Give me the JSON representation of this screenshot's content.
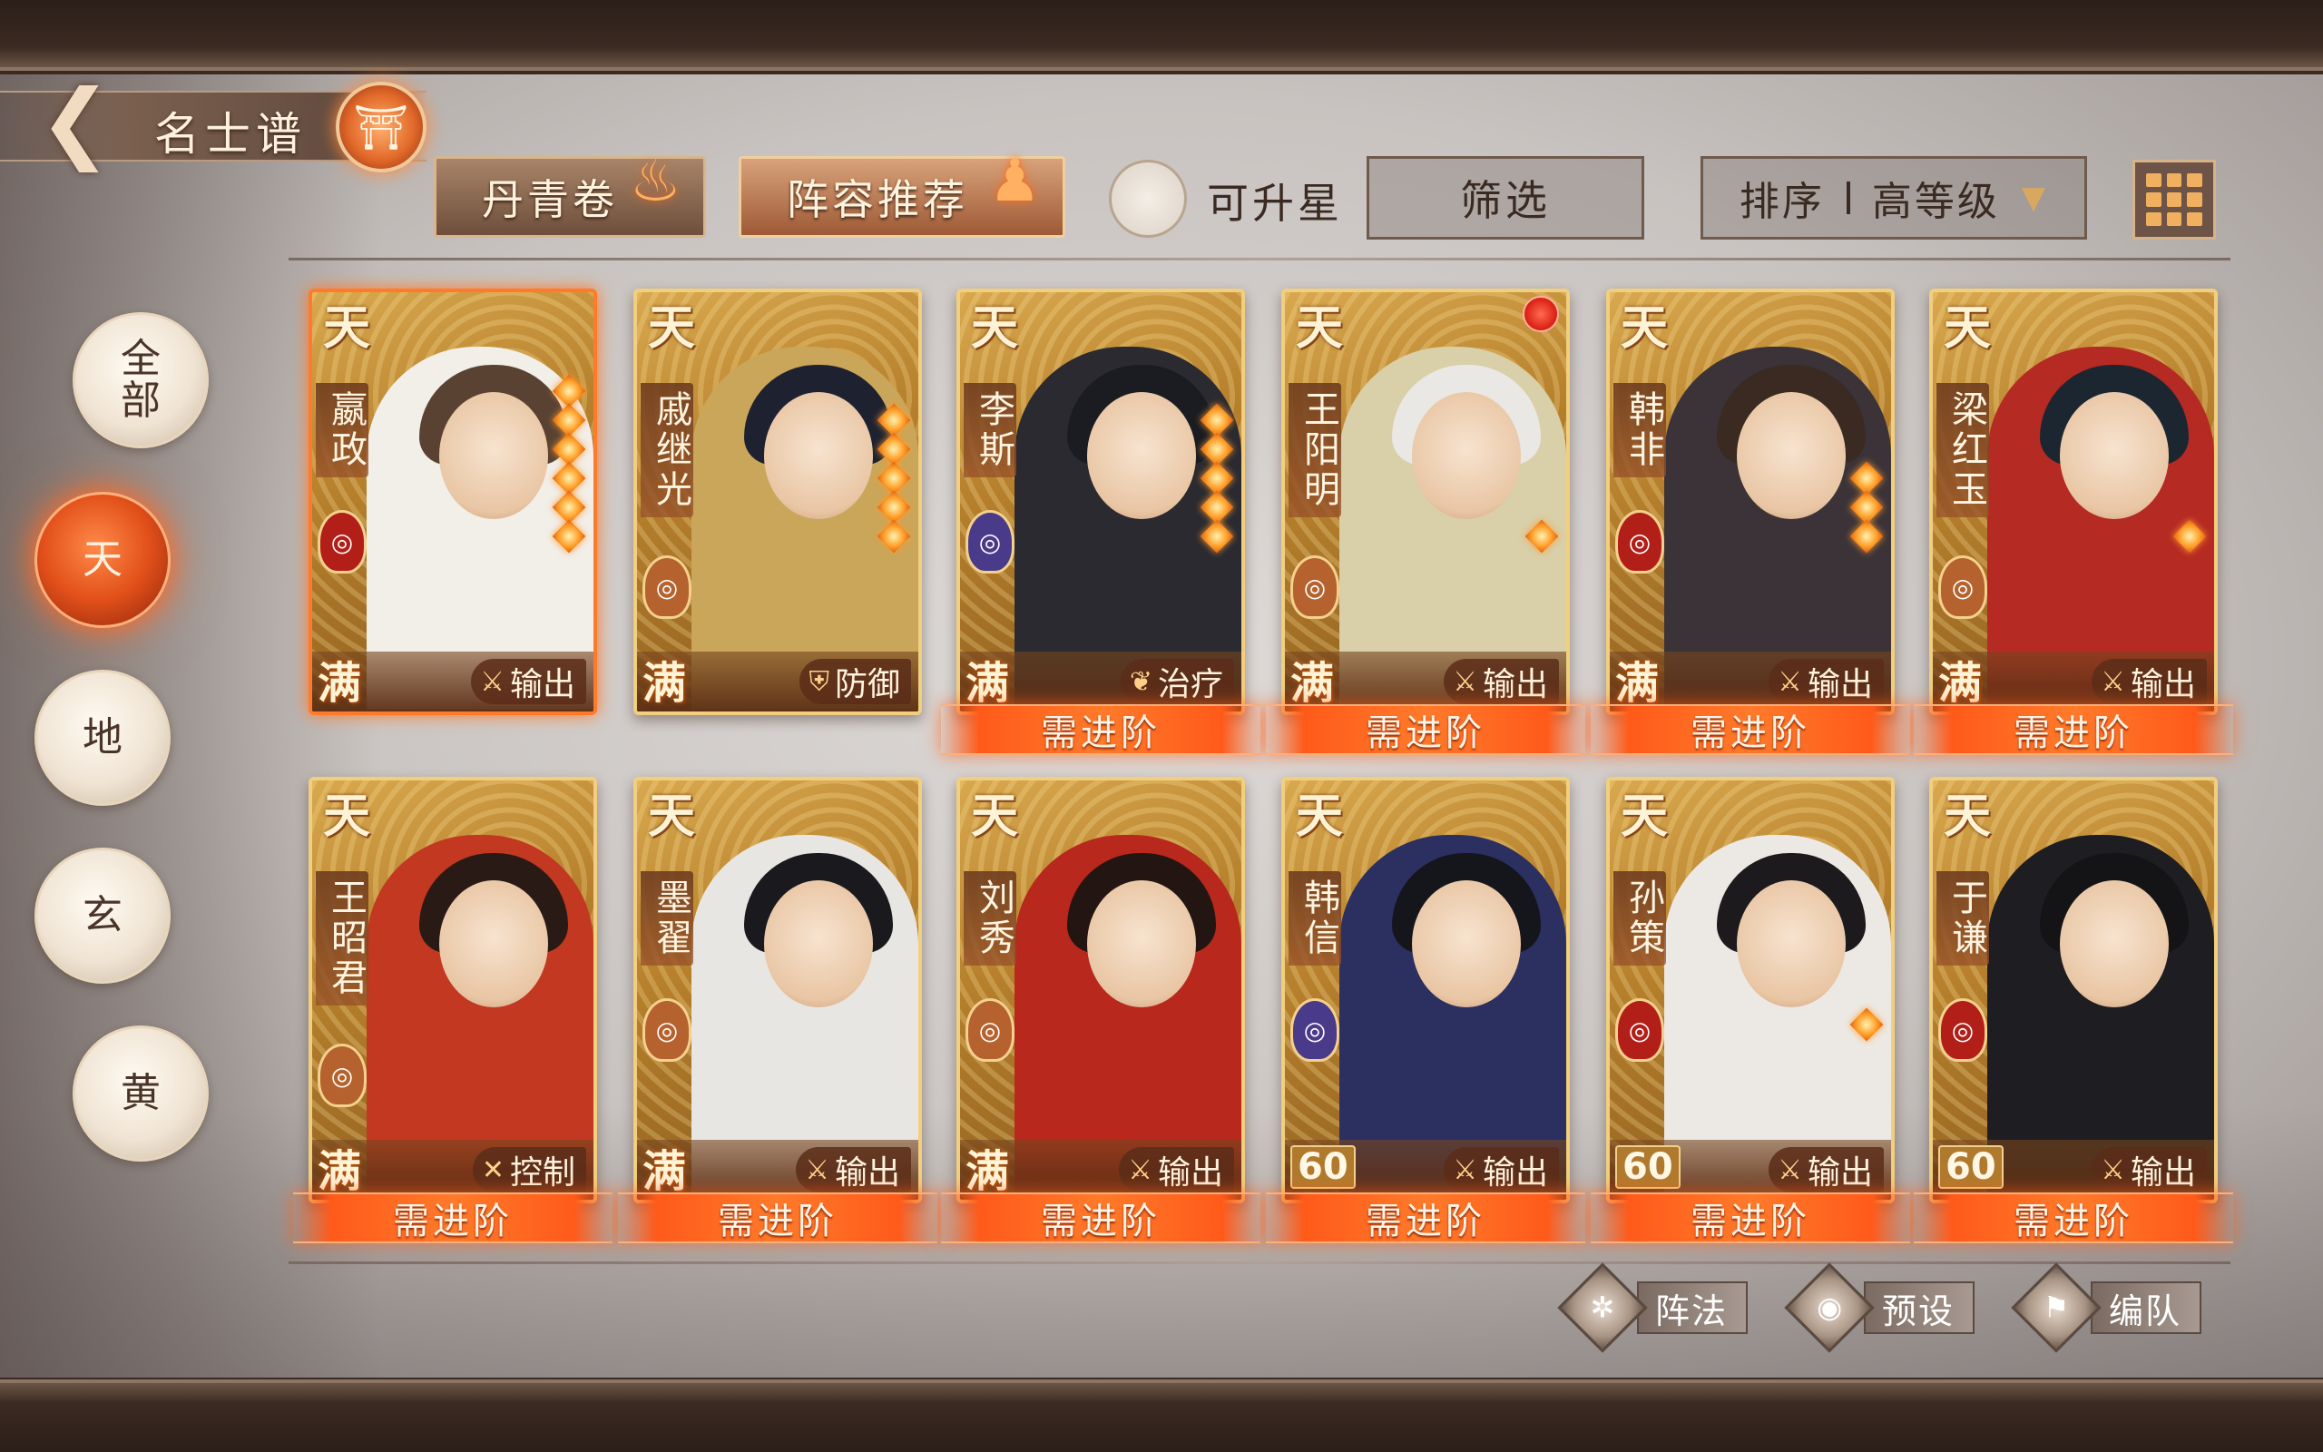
{
  "header": {
    "back_icon": "arrow-left-icon",
    "title": "名士谱",
    "tabs": [
      {
        "label": "丹青卷",
        "icon": "flame-icon"
      },
      {
        "label": "阵容推荐",
        "icon": "dancer-icon"
      }
    ],
    "upgrade_label": "可升星",
    "filter_label": "筛选",
    "sort_label": "排序",
    "sort_value": "高等级",
    "view_icon": "grid-icon"
  },
  "categories": [
    {
      "label_1": "全",
      "label_2": "部",
      "active": false
    },
    {
      "label_1": "天",
      "label_2": "",
      "active": true
    },
    {
      "label_1": "地",
      "label_2": "",
      "active": false
    },
    {
      "label_1": "玄",
      "label_2": "",
      "active": false
    },
    {
      "label_1": "黄",
      "label_2": "",
      "active": false
    }
  ],
  "advance_label": "需进阶",
  "cards": [
    {
      "tier": "天",
      "name": "嬴政",
      "level": "满",
      "role": "输出",
      "role_icon": "sword-icon",
      "faction_color": "#b21e18",
      "hair": "#5a4232",
      "robe": "#f2eee8",
      "stars": 6,
      "needs_advance": false,
      "selected": true
    },
    {
      "tier": "天",
      "name": "戚继光",
      "level": "满",
      "role": "防御",
      "role_icon": "shield-icon",
      "faction_color": "#b5622e",
      "hair": "#1e2230",
      "robe": "#c9a65a",
      "stars": 5,
      "needs_advance": false,
      "selected": false
    },
    {
      "tier": "天",
      "name": "李斯",
      "level": "满",
      "role": "治疗",
      "role_icon": "leaf-icon",
      "faction_color": "#4a3a8a",
      "hair": "#1a1c22",
      "robe": "#2a2a30",
      "stars": 5,
      "needs_advance": true,
      "selected": false
    },
    {
      "tier": "天",
      "name": "王阳明",
      "level": "满",
      "role": "输出",
      "role_icon": "sword-icon",
      "faction_color": "#b5622e",
      "hair": "#eae8e4",
      "robe": "#d9cfa8",
      "stars": 1,
      "needs_advance": true,
      "selected": false,
      "badge": true
    },
    {
      "tier": "天",
      "name": "韩非",
      "level": "满",
      "role": "输出",
      "role_icon": "sword-icon",
      "faction_color": "#b21e18",
      "hair": "#3a2a22",
      "robe": "#3b3338",
      "stars": 3,
      "needs_advance": true,
      "selected": false
    },
    {
      "tier": "天",
      "name": "梁红玉",
      "level": "满",
      "role": "输出",
      "role_icon": "sword-icon",
      "faction_color": "#b5622e",
      "hair": "#1c2630",
      "robe": "#b52a22",
      "stars": 1,
      "needs_advance": true,
      "selected": false
    },
    {
      "tier": "天",
      "name": "王昭君",
      "level": "满",
      "role": "控制",
      "role_icon": "cross-icon",
      "faction_color": "#b5622e",
      "hair": "#2a1a16",
      "robe": "#c23820",
      "stars": 0,
      "needs_advance": true,
      "selected": false
    },
    {
      "tier": "天",
      "name": "墨翟",
      "level": "满",
      "role": "输出",
      "role_icon": "sword-icon",
      "faction_color": "#b5622e",
      "hair": "#1a1a1e",
      "robe": "#e8e6e2",
      "stars": 0,
      "needs_advance": true,
      "selected": false
    },
    {
      "tier": "天",
      "name": "刘秀",
      "level": "满",
      "role": "输出",
      "role_icon": "sword-icon",
      "faction_color": "#b5622e",
      "hair": "#231612",
      "robe": "#b8281c",
      "stars": 0,
      "needs_advance": true,
      "selected": false
    },
    {
      "tier": "天",
      "name": "韩信",
      "level": "60",
      "role": "输出",
      "role_icon": "sword-icon",
      "faction_color": "#4a3a8a",
      "hair": "#15161c",
      "robe": "#2c3060",
      "stars": 0,
      "needs_advance": true,
      "selected": false
    },
    {
      "tier": "天",
      "name": "孙策",
      "level": "60",
      "role": "输出",
      "role_icon": "sword-icon",
      "faction_color": "#b21e18",
      "hair": "#1c1a1c",
      "robe": "#ece9e4",
      "stars": 1,
      "needs_advance": true,
      "selected": false
    },
    {
      "tier": "天",
      "name": "于谦",
      "level": "60",
      "role": "输出",
      "role_icon": "sword-icon",
      "faction_color": "#b21e18",
      "hair": "#141416",
      "robe": "#1e1e22",
      "stars": 0,
      "needs_advance": true,
      "selected": false
    }
  ],
  "actions": [
    {
      "label": "阵法",
      "icon": "formation-icon"
    },
    {
      "label": "预设",
      "icon": "preset-icon"
    },
    {
      "label": "编队",
      "icon": "banner-icon"
    }
  ]
}
